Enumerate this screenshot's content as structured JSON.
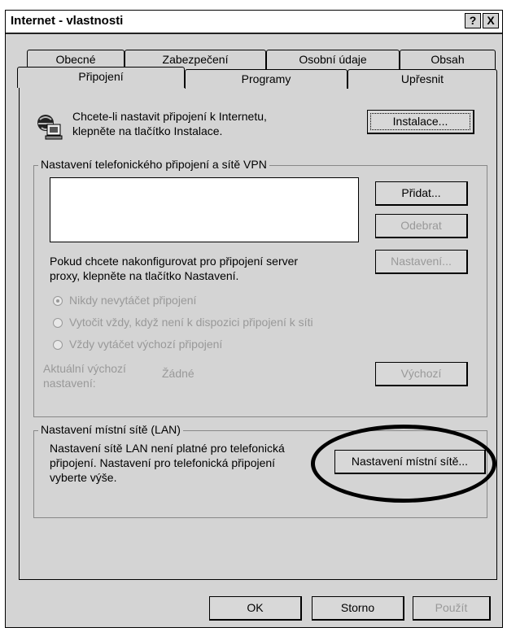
{
  "window": {
    "title": "Internet - vlastnosti",
    "help_button": "?",
    "close_button": "X"
  },
  "tabs_back": [
    "Obecné",
    "Zabezpečení",
    "Osobní údaje",
    "Obsah"
  ],
  "tabs_front": [
    "Připojení",
    "Programy",
    "Upřesnit"
  ],
  "setup": {
    "text_line1": "Chcete-li nastavit připojení k Internetu,",
    "text_line2": "klepněte na tlačítko Instalace.",
    "install_button": "Instalace..."
  },
  "dialup": {
    "group_label": "Nastavení telefonického připojení a sítě VPN",
    "add_button": "Přidat...",
    "remove_button": "Odebrat",
    "proxy_text_line1": "Pokud chcete nakonfigurovat pro připojení server",
    "proxy_text_line2": "proxy, klepněte na tlačítko Nastavení.",
    "settings_button": "Nastavení...",
    "radio_never": "Nikdy nevytáčet připojení",
    "radio_when_no_network": "Vytočit vždy, když není k dispozici připojení k síti",
    "radio_always": "Vždy vytáčet výchozí připojení",
    "current_default_label_line1": "Aktuální výchozí",
    "current_default_label_line2": "nastavení:",
    "current_default_value": "Žádné",
    "default_button": "Výchozí"
  },
  "lan": {
    "group_label": "Nastavení místní sítě (LAN)",
    "text_line1": "Nastavení sítě LAN není platné pro telefonická",
    "text_line2": "připojení. Nastavení pro telefonická připojení",
    "text_line3": "vyberte výše.",
    "lan_settings_button": "Nastavení místní sítě..."
  },
  "footer": {
    "ok_button": "OK",
    "cancel_button": "Storno",
    "apply_button": "Použít"
  }
}
